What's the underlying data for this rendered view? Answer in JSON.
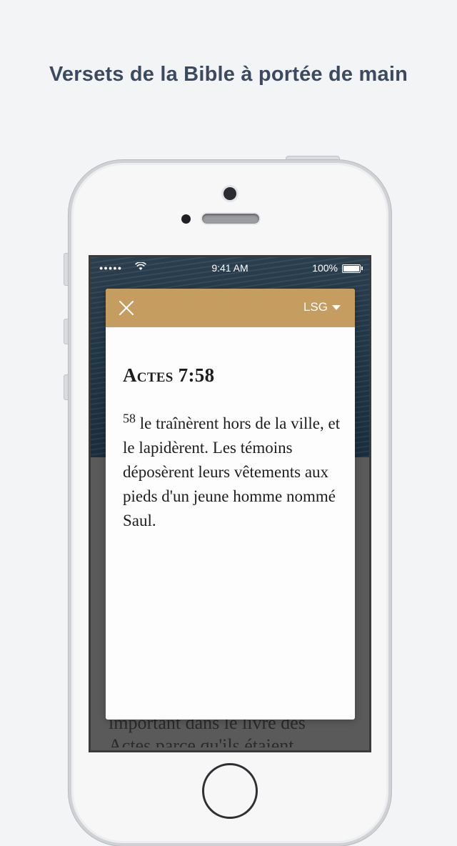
{
  "headline": "Versets de la Bible à portée de main",
  "status_bar": {
    "signal": "●●●●●",
    "time": "9:41 AM",
    "battery": "100%"
  },
  "background_text": "important dans le livre des Actes parce qu'ils étaient",
  "modal": {
    "version_label": "LSG",
    "reference": "Actes 7:58",
    "verse_number": "58",
    "verse_text": "le traînèrent hors de la ville, et le lapidèrent. Les témoins déposèrent leurs vêtements aux pieds d'un jeune homme nommé Saul.",
    "header_color": "#c59d61"
  },
  "icons": [
    "close-icon",
    "chevron-down-icon",
    "wifi-icon",
    "battery-icon"
  ]
}
